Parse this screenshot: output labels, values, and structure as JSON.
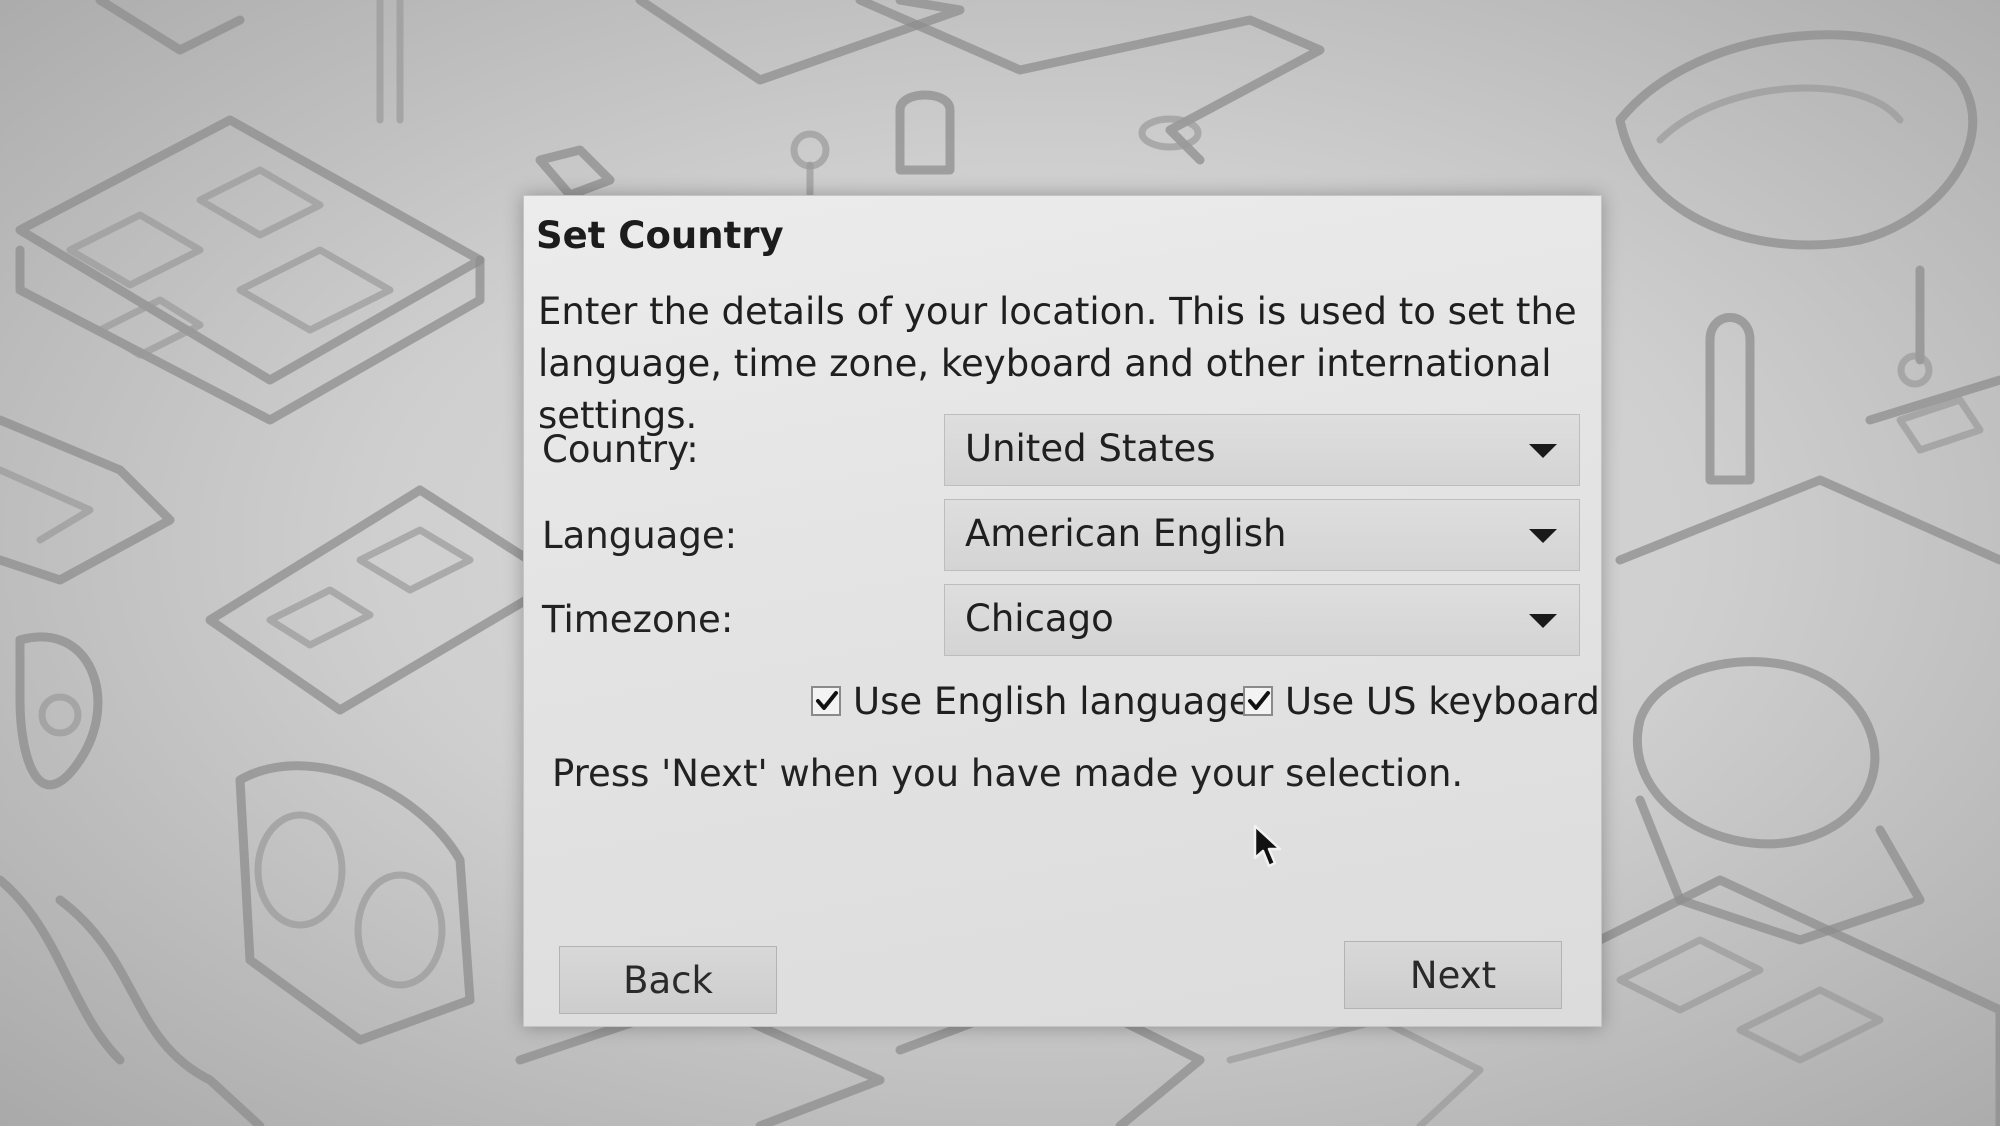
{
  "dialog": {
    "title": "Set Country",
    "intro": "Enter the details of your location. This is used to set the language, time zone, keyboard and other international settings.",
    "fields": [
      {
        "label": "Country:",
        "value": "United States"
      },
      {
        "label": "Language:",
        "value": "American English"
      },
      {
        "label": "Timezone:",
        "value": "Chicago"
      }
    ],
    "checkboxes": [
      {
        "label": "Use English language",
        "checked": true
      },
      {
        "label": "Use US keyboard",
        "checked": true
      }
    ],
    "hint": "Press 'Next' when you have made your selection.",
    "back_label": "Back",
    "next_label": "Next"
  },
  "icons": {
    "dropdown": "chevron-down-icon",
    "checkmark": "checkmark-icon",
    "pointer": "mouse-pointer-icon"
  },
  "colors": {
    "dialog_background": "#e6e6e6",
    "button_background": "#d3d3d3",
    "wallpaper_line": "#8e8e8e"
  }
}
